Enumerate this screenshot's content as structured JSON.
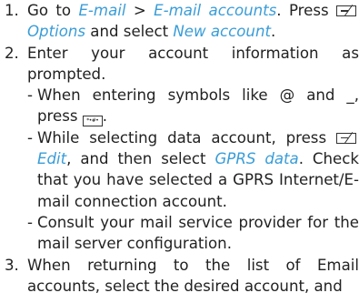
{
  "steps": [
    {
      "number": "1.",
      "parts": {
        "t1": "Go to ",
        "l1": "E-mail",
        "t2": " > ",
        "l2": "E-mail accounts",
        "t3": ". Press ",
        "l3": "Options",
        "t4": " and select ",
        "l4": "New account",
        "t5": "."
      }
    },
    {
      "number": "2.",
      "text": "Enter your account information as prompted.",
      "sub": [
        {
          "dash": "-",
          "t1": "When entering symbols like @ and _, press ",
          "key": "*•#•",
          "t2": "."
        },
        {
          "dash": "-",
          "t1": "While selecting data account, press ",
          "l1": "Edit",
          "t2": ", and then select ",
          "l2": "GPRS data",
          "t3": ". Check that you have selected a GPRS Internet/E-mail connection account."
        },
        {
          "dash": "-",
          "t1": "Consult your mail service provider for the mail server configuration."
        }
      ]
    },
    {
      "number": "3.",
      "text": "When returning to the list of Email accounts, select the desired account, and"
    }
  ],
  "icons": {
    "softkey": "left-softkey-icon",
    "symbol_key": "symbol-key-icon"
  },
  "colors": {
    "text": "#222222",
    "link": "#3a9dd8"
  }
}
